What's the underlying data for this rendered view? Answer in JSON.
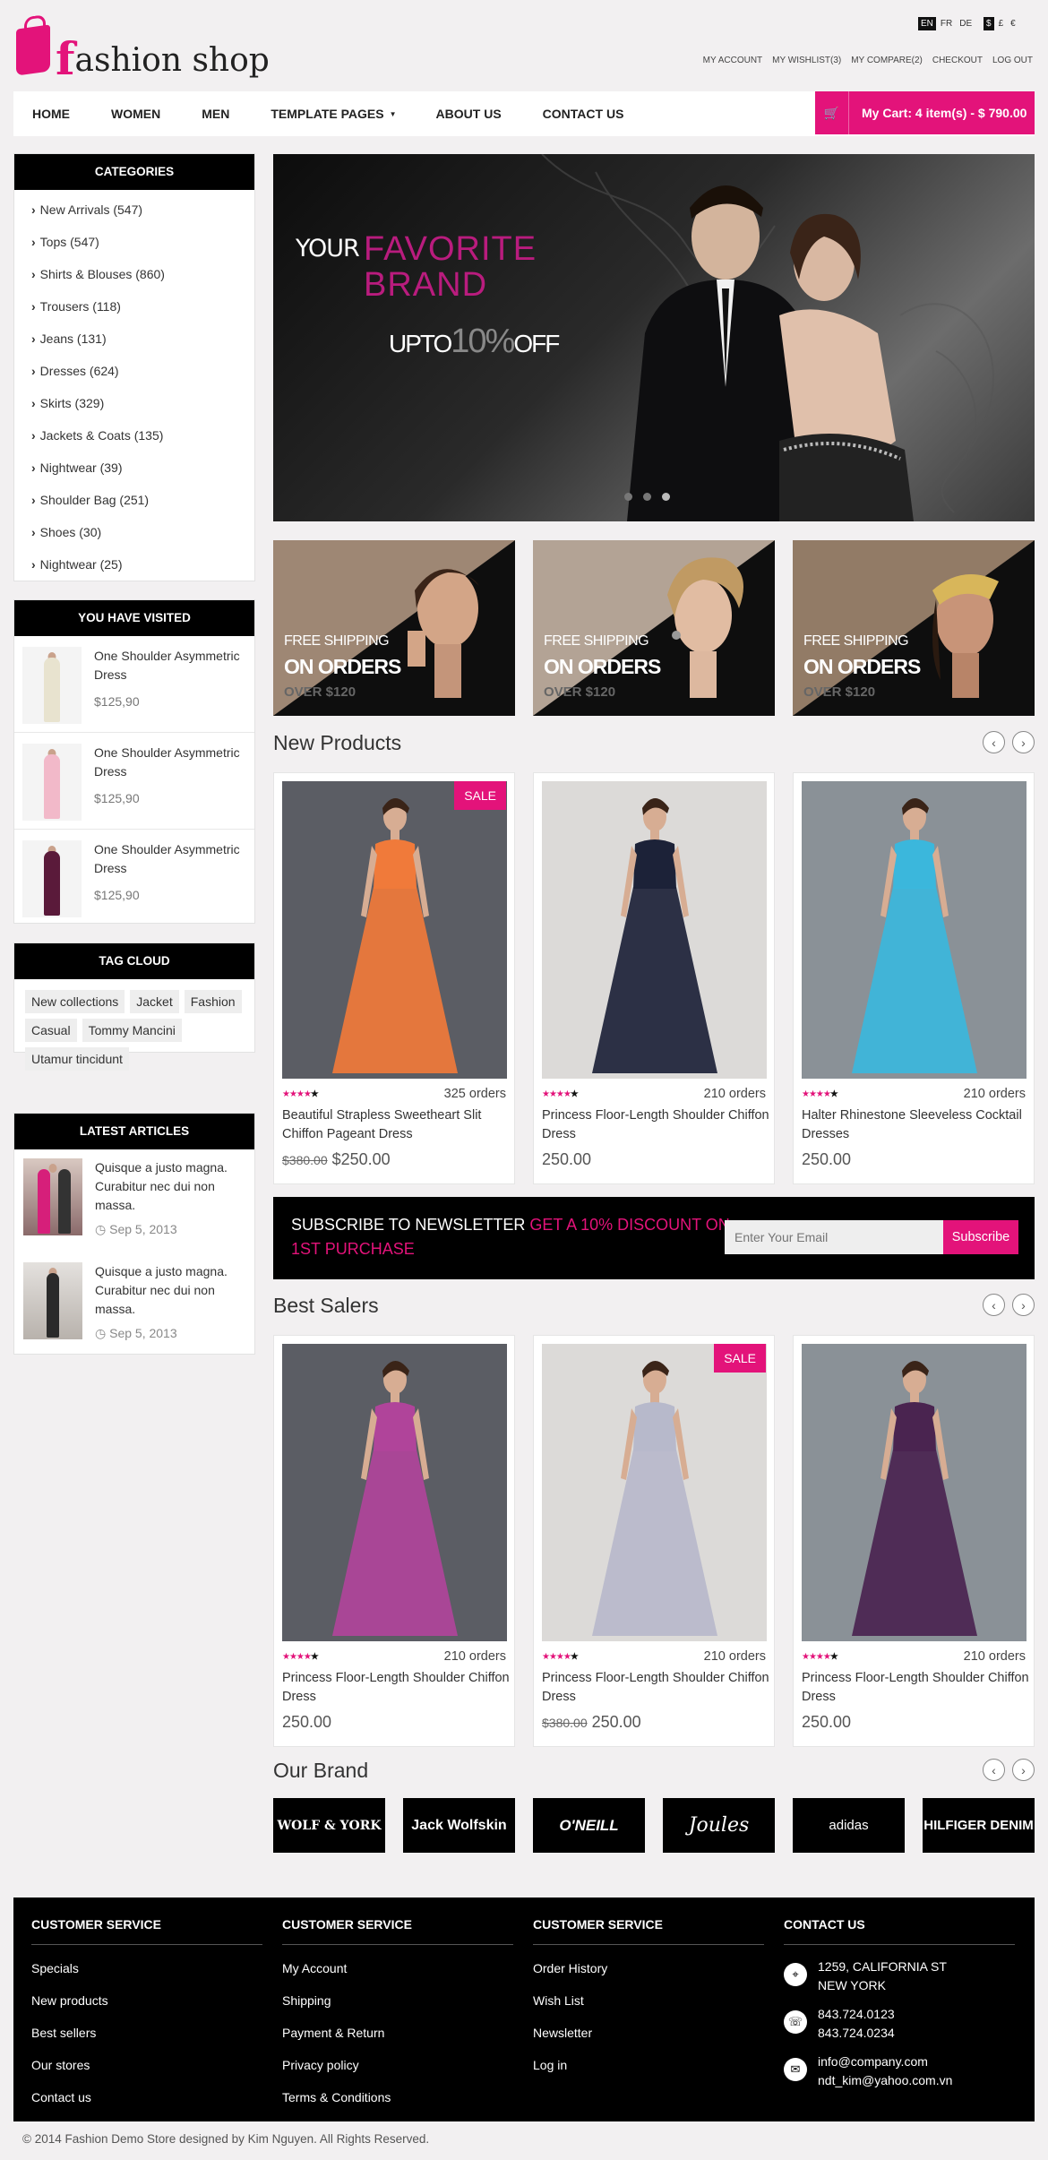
{
  "header": {
    "logo_text": "fashion shop",
    "languages": [
      "EN",
      "FR",
      "DE"
    ],
    "currencies": [
      "$",
      "£",
      "€"
    ],
    "top_links": [
      "MY ACCOUNT",
      "MY WISHLIST(3)",
      "MY COMPARE(2)",
      "CHECKOUT",
      "LOG OUT"
    ]
  },
  "nav": {
    "items": [
      "HOME",
      "WOMEN",
      "MEN",
      "TEMPLATE PAGES",
      "ABOUT US",
      "CONTACT US"
    ],
    "cart_label": "My Cart: 4 item(s) - $ 790.00"
  },
  "sidebar": {
    "categories_title": "CATEGORIES",
    "categories": [
      "New Arrivals (547)",
      "Tops (547)",
      "Shirts & Blouses (860)",
      "Trousers (118)",
      "Jeans (131)",
      "Dresses (624)",
      "Skirts (329)",
      "Jackets & Coats (135)",
      "Nightwear (39)",
      "Shoulder Bag (251)",
      "Shoes (30)",
      "Nightwear (25)"
    ],
    "visited_title": "YOU HAVE VISITED",
    "visited": [
      {
        "name": "One Shoulder Asymmetric Dress",
        "price": "$125,90"
      },
      {
        "name": "One Shoulder Asymmetric Dress",
        "price": "$125,90"
      },
      {
        "name": "One Shoulder Asymmetric Dress",
        "price": "$125,90"
      }
    ],
    "tags_title": "TAG CLOUD",
    "tags": [
      "New collections",
      "Jacket",
      "Fashion",
      "Casual",
      "Tommy Mancini",
      "Utamur tincidunt"
    ],
    "articles_title": "LATEST ARTICLES",
    "articles": [
      {
        "text": "Quisque a justo magna. Curabitur nec dui non massa.",
        "date": "Sep 5, 2013"
      },
      {
        "text": "Quisque a justo magna. Curabitur nec dui non massa.",
        "date": "Sep 5, 2013"
      }
    ]
  },
  "slider": {
    "line1": "YOUR",
    "line2": "FAVORITE BRAND",
    "line3_pre": "UPTO",
    "line3_num": "10%",
    "line3_post": "OFF"
  },
  "promos": [
    {
      "t1": "FREE SHIPPING",
      "t2": "ON ORDERS",
      "t3": "OVER $120"
    },
    {
      "t1": "FREE SHIPPING",
      "t2": "ON ORDERS",
      "t3": "OVER $120"
    },
    {
      "t1": "FREE SHIPPING",
      "t2": "ON ORDERS",
      "t3": "OVER $120"
    }
  ],
  "new_products": {
    "title": "New Products",
    "items": [
      {
        "sale": "SALE",
        "orders": "325 orders",
        "name": "Beautiful Strapless Sweetheart Slit Chiffon Pageant Dress",
        "old_price": "$380.00",
        "price": "$250.00",
        "dress_color": "#f07a3a"
      },
      {
        "orders": "210 orders",
        "name": "Princess Floor-Length Shoulder Chiffon Dress",
        "price": "250.00",
        "dress_color": "#1c2238"
      },
      {
        "orders": "210 orders",
        "name": "Halter Rhinestone Sleeveless Cocktail Dresses",
        "price": "250.00",
        "dress_color": "#3bb7dc"
      }
    ]
  },
  "newsletter": {
    "label": "SUBSCRIBE TO NEWSLETTER",
    "highlight": "GET A 10% DISCOUNT ON 1ST PURCHASE",
    "placeholder": "Enter Your Email",
    "button": "Subscribe"
  },
  "best_sellers": {
    "title": "Best Salers",
    "items": [
      {
        "orders": "210 orders",
        "name": "Princess Floor-Length Shoulder Chiffon Dress",
        "price": "250.00",
        "dress_color": "#b0449a"
      },
      {
        "sale": "SALE",
        "orders": "210 orders",
        "name": "Princess Floor-Length Shoulder Chiffon Dress",
        "old_price": "$380.00",
        "price": "250.00",
        "dress_color": "#b7b9cb"
      },
      {
        "orders": "210 orders",
        "name": "Princess Floor-Length Shoulder Chiffon Dress",
        "price": "250.00",
        "dress_color": "#4a2450"
      }
    ]
  },
  "brands": {
    "title": "Our Brand",
    "items": [
      "WOLF & YORK",
      "Jack Wolfskin",
      "O'NEILL",
      "Joules",
      "adidas",
      "HILFIGER DENIM"
    ]
  },
  "footer": {
    "col1": {
      "title": "CUSTOMER SERVICE",
      "links": [
        "Specials",
        "New products",
        "Best sellers",
        "Our stores",
        "Contact us"
      ]
    },
    "col2": {
      "title": "CUSTOMER SERVICE",
      "links": [
        "My Account",
        "Shipping",
        "Payment & Return",
        "Privacy policy",
        "Terms & Conditions"
      ]
    },
    "col3": {
      "title": "CUSTOMER SERVICE",
      "links": [
        "Order History",
        "Wish List",
        "Newsletter",
        "Log in"
      ]
    },
    "contact": {
      "title": "CONTACT US",
      "address1": "1259, CALIFORNIA ST",
      "address2": "NEW YORK",
      "phone1": "843.724.0123",
      "phone2": "843.724.0234",
      "email1": "info@company.com",
      "email2": "ndt_kim@yahoo.com.vn"
    },
    "copyright": "© 2014 Fashion Demo Store designed by Kim Nguyen. All Rights Reserved."
  },
  "colors": {
    "accent": "#e3137a",
    "dark": "#000000"
  }
}
